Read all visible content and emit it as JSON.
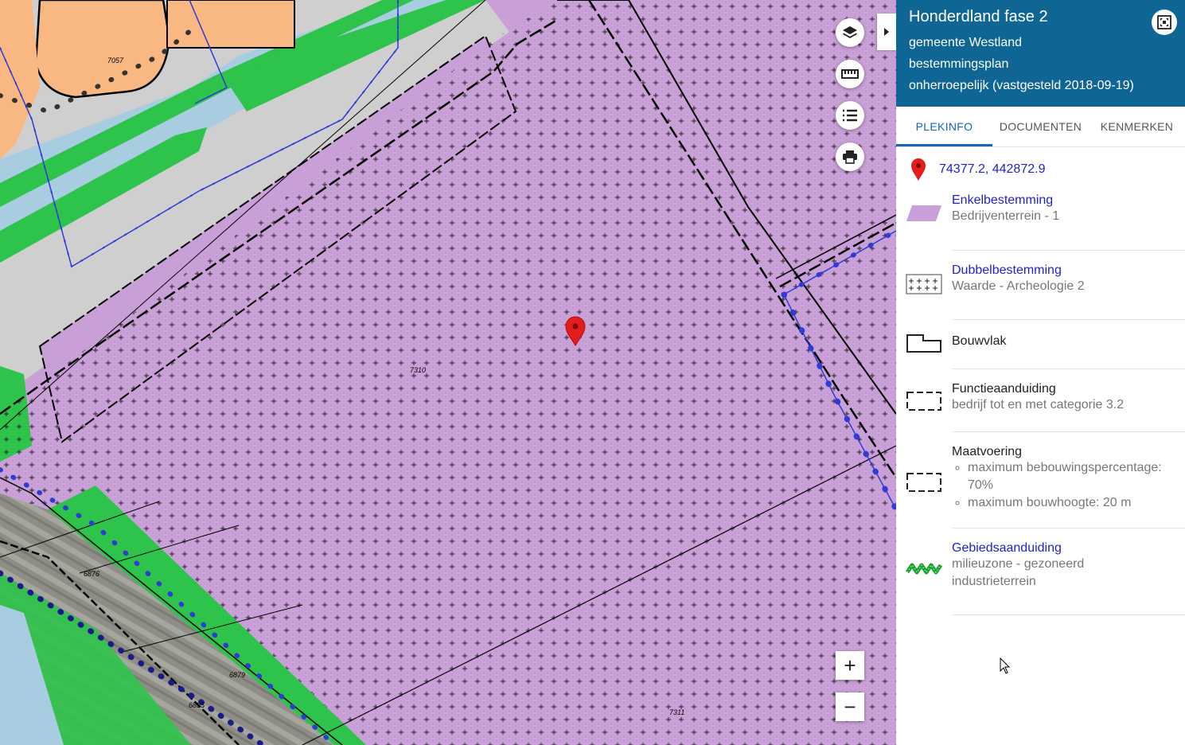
{
  "map": {
    "parcel_labels": [
      "7057",
      "7310",
      "6876",
      "6879",
      "6835",
      "7311"
    ],
    "tools": [
      "layers-icon",
      "ruler-icon",
      "list-icon",
      "print-icon"
    ],
    "zoom_in": "+",
    "zoom_out": "−",
    "colors": {
      "purple": "#c89fd6",
      "orange": "#f9b882",
      "green": "#2ec44b",
      "light_blue": "#a9cde0",
      "grey": "#cfcfcf",
      "marker": "#e31c1c"
    }
  },
  "panel": {
    "title": "Honderdland fase 2",
    "lines": [
      "gemeente Westland",
      "bestemmingsplan",
      "onherroepelijk (vastgesteld 2018-09-19)"
    ],
    "header_color": "#0f6695",
    "tabs": [
      "PLEKINFO",
      "DOCUMENTEN",
      "KENMERKEN"
    ],
    "active_tab": "PLEKINFO",
    "coordinates": "74377.2, 442872.9",
    "legend": [
      {
        "title": "Enkelbestemming",
        "sub": "Bedrijventerrein - 1",
        "icon": "purple-parallelogram-icon"
      },
      {
        "title": "Dubbelbestemming",
        "sub": "Waarde - Archeologie 2",
        "icon": "cross-hatch-icon"
      },
      {
        "title": "Bouwvlak",
        "icon": "building-plane-icon"
      },
      {
        "title": "Functieaanduiding",
        "sub": "bedrijf tot en met categorie 3.2",
        "icon": "dashed-rectangle-icon"
      },
      {
        "title": "Maatvoering",
        "items": [
          "maximum bebouwingspercentage: 70%",
          "maximum bouwhoogte: 20 m"
        ],
        "icon": "dashed-rectangle-icon"
      },
      {
        "title": "Gebiedsaanduiding",
        "sub": "milieuzone - gezoneerd industrieterrein",
        "icon": "green-zigzag-icon"
      }
    ]
  }
}
